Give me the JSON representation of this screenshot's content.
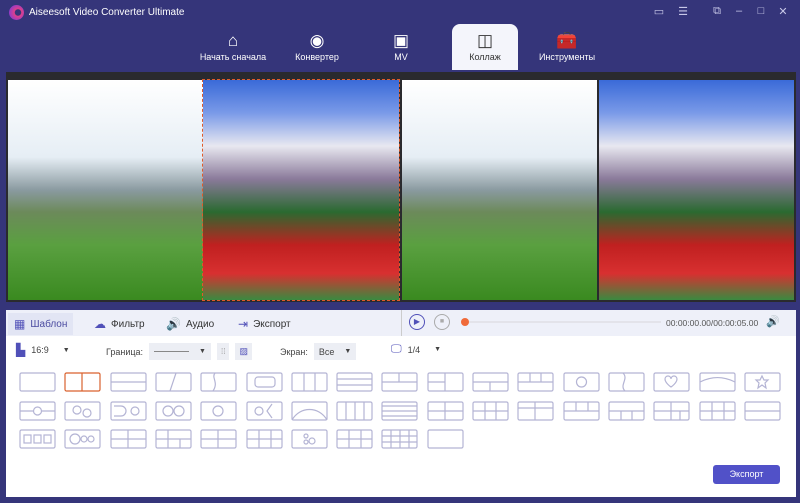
{
  "app": {
    "title": "Aiseesoft Video Converter Ultimate"
  },
  "nav": [
    {
      "label": "Начать сначала",
      "icon": "home-icon"
    },
    {
      "label": "Конвертер",
      "icon": "convert-icon"
    },
    {
      "label": "MV",
      "icon": "tv-icon"
    },
    {
      "label": "Коллаж",
      "icon": "collage-icon",
      "active": true
    },
    {
      "label": "Инструменты",
      "icon": "toolbox-icon"
    }
  ],
  "tabs": [
    {
      "label": "Шаблон",
      "icon": "template-icon",
      "active": true
    },
    {
      "label": "Фильтр",
      "icon": "filter-icon"
    },
    {
      "label": "Аудио",
      "icon": "audio-icon"
    },
    {
      "label": "Экспорт",
      "icon": "export-icon"
    }
  ],
  "player": {
    "time": "00:00:00.00/00:00:05.00",
    "progress": 0
  },
  "options": {
    "aspect": "16:9",
    "border_label": "Граница:",
    "screen_label": "Экран:",
    "screen_value": "Все",
    "page": "1/4"
  },
  "export_label": "Экспорт",
  "colors": {
    "accent": "#5151c8",
    "selected": "#e05a2a",
    "titlebar": "#35357a"
  }
}
